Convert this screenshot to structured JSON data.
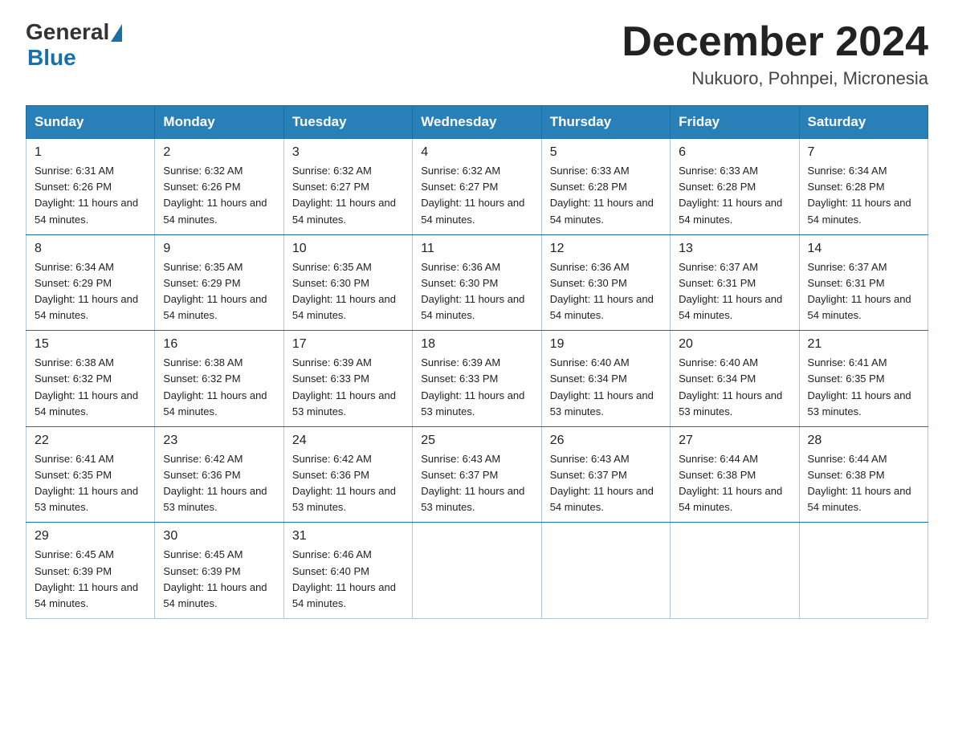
{
  "logo": {
    "general": "General",
    "blue": "Blue"
  },
  "title": "December 2024",
  "location": "Nukuoro, Pohnpei, Micronesia",
  "days_of_week": [
    "Sunday",
    "Monday",
    "Tuesday",
    "Wednesday",
    "Thursday",
    "Friday",
    "Saturday"
  ],
  "weeks": [
    [
      {
        "day": "1",
        "sunrise": "6:31 AM",
        "sunset": "6:26 PM",
        "daylight": "11 hours and 54 minutes."
      },
      {
        "day": "2",
        "sunrise": "6:32 AM",
        "sunset": "6:26 PM",
        "daylight": "11 hours and 54 minutes."
      },
      {
        "day": "3",
        "sunrise": "6:32 AM",
        "sunset": "6:27 PM",
        "daylight": "11 hours and 54 minutes."
      },
      {
        "day": "4",
        "sunrise": "6:32 AM",
        "sunset": "6:27 PM",
        "daylight": "11 hours and 54 minutes."
      },
      {
        "day": "5",
        "sunrise": "6:33 AM",
        "sunset": "6:28 PM",
        "daylight": "11 hours and 54 minutes."
      },
      {
        "day": "6",
        "sunrise": "6:33 AM",
        "sunset": "6:28 PM",
        "daylight": "11 hours and 54 minutes."
      },
      {
        "day": "7",
        "sunrise": "6:34 AM",
        "sunset": "6:28 PM",
        "daylight": "11 hours and 54 minutes."
      }
    ],
    [
      {
        "day": "8",
        "sunrise": "6:34 AM",
        "sunset": "6:29 PM",
        "daylight": "11 hours and 54 minutes."
      },
      {
        "day": "9",
        "sunrise": "6:35 AM",
        "sunset": "6:29 PM",
        "daylight": "11 hours and 54 minutes."
      },
      {
        "day": "10",
        "sunrise": "6:35 AM",
        "sunset": "6:30 PM",
        "daylight": "11 hours and 54 minutes."
      },
      {
        "day": "11",
        "sunrise": "6:36 AM",
        "sunset": "6:30 PM",
        "daylight": "11 hours and 54 minutes."
      },
      {
        "day": "12",
        "sunrise": "6:36 AM",
        "sunset": "6:30 PM",
        "daylight": "11 hours and 54 minutes."
      },
      {
        "day": "13",
        "sunrise": "6:37 AM",
        "sunset": "6:31 PM",
        "daylight": "11 hours and 54 minutes."
      },
      {
        "day": "14",
        "sunrise": "6:37 AM",
        "sunset": "6:31 PM",
        "daylight": "11 hours and 54 minutes."
      }
    ],
    [
      {
        "day": "15",
        "sunrise": "6:38 AM",
        "sunset": "6:32 PM",
        "daylight": "11 hours and 54 minutes."
      },
      {
        "day": "16",
        "sunrise": "6:38 AM",
        "sunset": "6:32 PM",
        "daylight": "11 hours and 54 minutes."
      },
      {
        "day": "17",
        "sunrise": "6:39 AM",
        "sunset": "6:33 PM",
        "daylight": "11 hours and 53 minutes."
      },
      {
        "day": "18",
        "sunrise": "6:39 AM",
        "sunset": "6:33 PM",
        "daylight": "11 hours and 53 minutes."
      },
      {
        "day": "19",
        "sunrise": "6:40 AM",
        "sunset": "6:34 PM",
        "daylight": "11 hours and 53 minutes."
      },
      {
        "day": "20",
        "sunrise": "6:40 AM",
        "sunset": "6:34 PM",
        "daylight": "11 hours and 53 minutes."
      },
      {
        "day": "21",
        "sunrise": "6:41 AM",
        "sunset": "6:35 PM",
        "daylight": "11 hours and 53 minutes."
      }
    ],
    [
      {
        "day": "22",
        "sunrise": "6:41 AM",
        "sunset": "6:35 PM",
        "daylight": "11 hours and 53 minutes."
      },
      {
        "day": "23",
        "sunrise": "6:42 AM",
        "sunset": "6:36 PM",
        "daylight": "11 hours and 53 minutes."
      },
      {
        "day": "24",
        "sunrise": "6:42 AM",
        "sunset": "6:36 PM",
        "daylight": "11 hours and 53 minutes."
      },
      {
        "day": "25",
        "sunrise": "6:43 AM",
        "sunset": "6:37 PM",
        "daylight": "11 hours and 53 minutes."
      },
      {
        "day": "26",
        "sunrise": "6:43 AM",
        "sunset": "6:37 PM",
        "daylight": "11 hours and 54 minutes."
      },
      {
        "day": "27",
        "sunrise": "6:44 AM",
        "sunset": "6:38 PM",
        "daylight": "11 hours and 54 minutes."
      },
      {
        "day": "28",
        "sunrise": "6:44 AM",
        "sunset": "6:38 PM",
        "daylight": "11 hours and 54 minutes."
      }
    ],
    [
      {
        "day": "29",
        "sunrise": "6:45 AM",
        "sunset": "6:39 PM",
        "daylight": "11 hours and 54 minutes."
      },
      {
        "day": "30",
        "sunrise": "6:45 AM",
        "sunset": "6:39 PM",
        "daylight": "11 hours and 54 minutes."
      },
      {
        "day": "31",
        "sunrise": "6:46 AM",
        "sunset": "6:40 PM",
        "daylight": "11 hours and 54 minutes."
      },
      null,
      null,
      null,
      null
    ]
  ],
  "colors": {
    "header_bg": "#2980b9",
    "border": "#1a6fa8"
  }
}
